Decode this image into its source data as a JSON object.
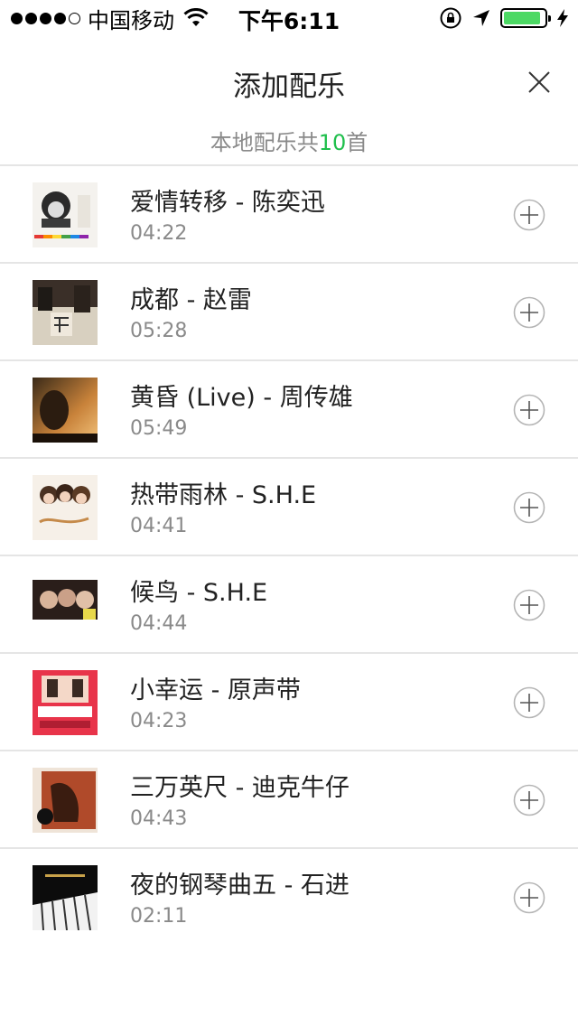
{
  "status_bar": {
    "carrier": "中国移动",
    "time": "下午6:11",
    "battery_level": 0.9,
    "signal_bars": 4,
    "battery_color": "#4cd964"
  },
  "header": {
    "title": "添加配乐",
    "close_icon": "close-icon",
    "subtitle_prefix": "本地配乐共",
    "subtitle_count": "10",
    "subtitle_suffix": "首",
    "accent_color": "#1fbf4c"
  },
  "songs": [
    {
      "title": "爱情转移 - 陈奕迅",
      "duration": "04:22",
      "cover": "cover-eason"
    },
    {
      "title": "成都 - 赵雷",
      "duration": "05:28",
      "cover": "cover-chengdu"
    },
    {
      "title": "黄昏 (Live) - 周传雄",
      "duration": "05:49",
      "cover": "cover-huanghun"
    },
    {
      "title": "热带雨林 - S.H.E",
      "duration": "04:41",
      "cover": "cover-together"
    },
    {
      "title": "候鸟 - S.H.E",
      "duration": "04:44",
      "cover": "cover-houniao"
    },
    {
      "title": "小幸运 - 原声带",
      "duration": "04:23",
      "cover": "cover-xiaoxingyun"
    },
    {
      "title": "三万英尺 - 迪克牛仔",
      "duration": "04:43",
      "cover": "cover-sanwan"
    },
    {
      "title": "夜的钢琴曲五 - 石进",
      "duration": "02:11",
      "cover": "cover-piano"
    }
  ],
  "add_icon": "plus-circle-icon"
}
